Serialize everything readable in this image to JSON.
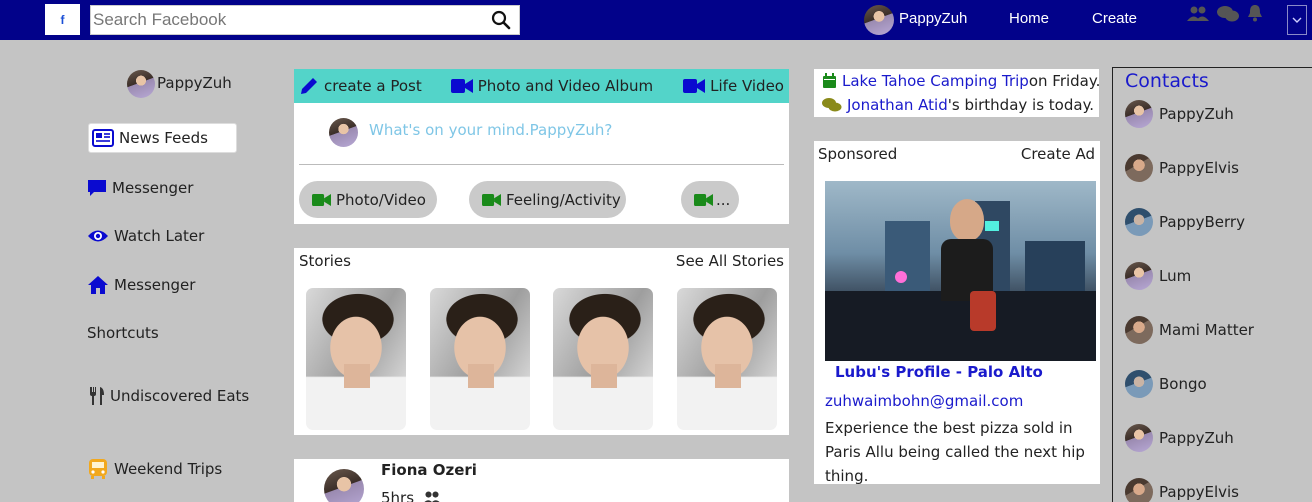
{
  "topbar": {
    "logo": "f",
    "search_placeholder": "Search Facebook",
    "user_name": "PappyZuh",
    "nav": [
      "Home",
      "Create"
    ]
  },
  "sidebar": {
    "user_name": "PappyZuh",
    "items": [
      {
        "label": "News Feeds",
        "icon": "newspaper-icon"
      },
      {
        "label": "Messenger",
        "icon": "chat-bubble-icon"
      },
      {
        "label": "Watch Later",
        "icon": "eye-icon"
      },
      {
        "label": "Messenger",
        "icon": "home-icon"
      }
    ],
    "shortcuts_label": "Shortcuts",
    "shortcuts": [
      {
        "label": "Undiscovered Eats",
        "icon": "utensils-icon"
      },
      {
        "label": "Weekend Trips",
        "icon": "bus-icon"
      }
    ]
  },
  "composer": {
    "tabs": [
      "create a Post",
      "Photo and Video Album",
      "Life Video"
    ],
    "prompt": "What's on your mind.PappyZuh?",
    "actions": [
      "Photo/Video",
      "Feeling/Activity",
      "..."
    ]
  },
  "stories": {
    "title": "Stories",
    "see_all": "See All Stories"
  },
  "feed_post": {
    "author": "Fiona Ozeri",
    "time": "5hrs"
  },
  "events": [
    {
      "link": "Lake Tahoe Camping Trip",
      "text": " on Friday.",
      "icon": "calendar-icon"
    },
    {
      "link": "Jonathan Atid",
      "text": " 's birthday is today.",
      "icon": "comments-icon"
    }
  ],
  "sponsored": {
    "label": "Sponsored",
    "create_ad": "Create Ad",
    "profile_link": "Lubu's Profile - Palo Alto",
    "email": "zuhwaimbohn@gmail.com",
    "description": "Experience the best pizza sold in Paris Allu being called the next hip thing."
  },
  "contacts": {
    "title": "Contacts",
    "list": [
      "PappyZuh",
      "PappyElvis",
      "PappyBerry",
      "Lum",
      "Mami Matter",
      "Bongo",
      "PappyZuh",
      "PappyElvis"
    ]
  },
  "colors": {
    "topbar": "#02028a",
    "accent_blue": "#1a1acc",
    "composer_tabs": "#53d4c9",
    "green_icon": "#1a8a1a",
    "background": "#c4c4c4"
  }
}
